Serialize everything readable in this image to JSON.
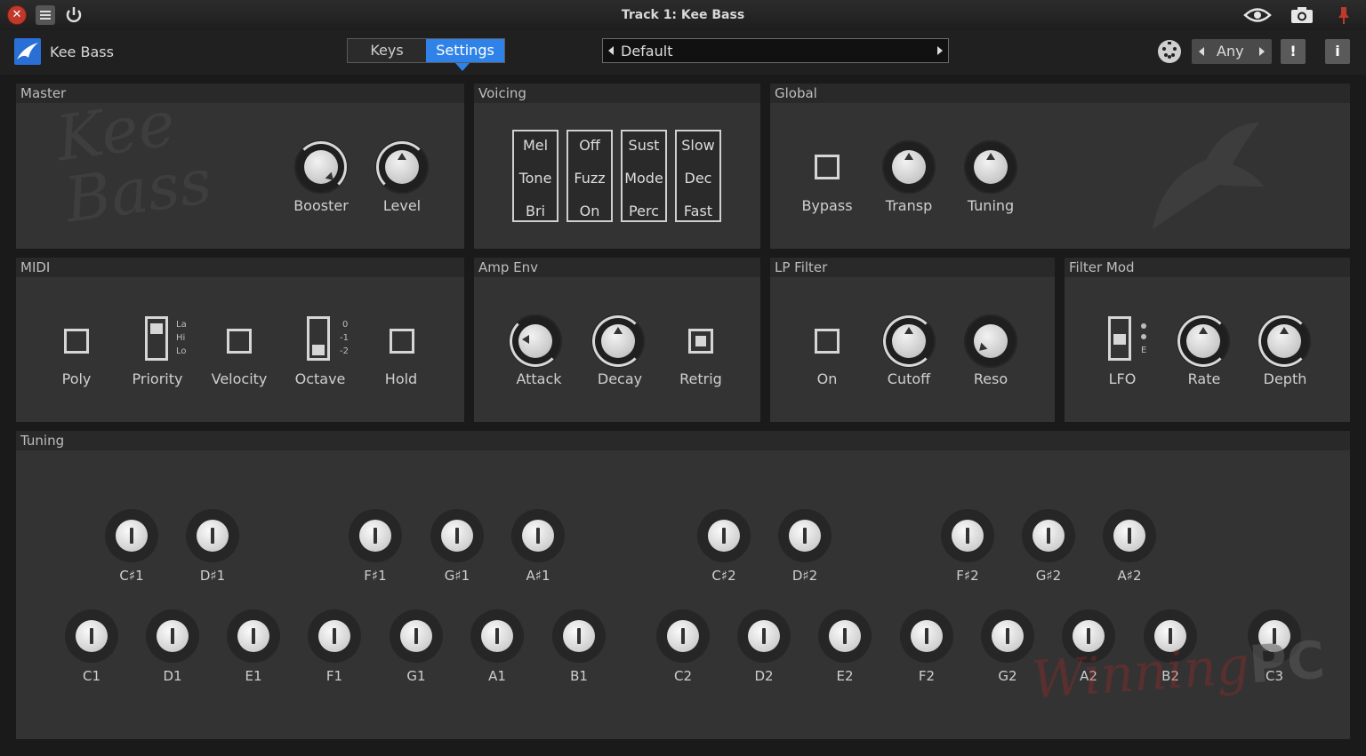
{
  "window": {
    "title": "Track 1: Kee Bass"
  },
  "toolbar": {
    "plugin_name": "Kee Bass",
    "tabs": [
      {
        "label": "Keys",
        "active": false
      },
      {
        "label": "Settings",
        "active": true
      }
    ],
    "preset": "Default",
    "channel": "Any",
    "alert_label": "!",
    "info_label": "i"
  },
  "colors": {
    "accent": "#2f83e8",
    "close": "#c0392b",
    "panel": "#333333"
  },
  "master": {
    "title": "Master",
    "logo_text_line1": "Kee",
    "logo_text_line2": "Bass",
    "knobs": [
      {
        "label": "Booster"
      },
      {
        "label": "Level"
      }
    ]
  },
  "voicing": {
    "title": "Voicing",
    "buttons": [
      {
        "options": [
          "Mel",
          "Tone",
          "Bri"
        ]
      },
      {
        "options": [
          "Off",
          "Fuzz",
          "On"
        ]
      },
      {
        "options": [
          "Sust",
          "Mode",
          "Perc"
        ]
      },
      {
        "options": [
          "Slow",
          "Dec",
          "Fast"
        ]
      }
    ]
  },
  "global": {
    "title": "Global",
    "bypass_label": "Bypass",
    "knobs": [
      {
        "label": "Transp"
      },
      {
        "label": "Tuning"
      }
    ]
  },
  "midi": {
    "title": "MIDI",
    "poly_label": "Poly",
    "priority_label": "Priority",
    "priority_options": [
      "La",
      "Hi",
      "Lo"
    ],
    "velocity_label": "Velocity",
    "octave_label": "Octave",
    "octave_options": [
      "0",
      "-1",
      "-2"
    ],
    "hold_label": "Hold"
  },
  "amp_env": {
    "title": "Amp Env",
    "attack_label": "Attack",
    "decay_label": "Decay",
    "retrig_label": "Retrig"
  },
  "lp_filter": {
    "title": "LP Filter",
    "on_label": "On",
    "cutoff_label": "Cutoff",
    "reso_label": "Reso"
  },
  "filter_mod": {
    "title": "Filter Mod",
    "lfo_label": "LFO",
    "lfo_mark": "E",
    "rate_label": "Rate",
    "depth_label": "Depth"
  },
  "tuning": {
    "title": "Tuning",
    "sharps": [
      "C♯1",
      "D♯1",
      "F♯1",
      "G♯1",
      "A♯1",
      "C♯2",
      "D♯2",
      "F♯2",
      "G♯2",
      "A♯2"
    ],
    "naturals": [
      "C1",
      "D1",
      "E1",
      "F1",
      "G1",
      "A1",
      "B1",
      "C2",
      "D2",
      "E2",
      "F2",
      "G2",
      "A2",
      "B2",
      "C3"
    ]
  },
  "watermark": {
    "script": "Winning",
    "pc": "PC"
  }
}
